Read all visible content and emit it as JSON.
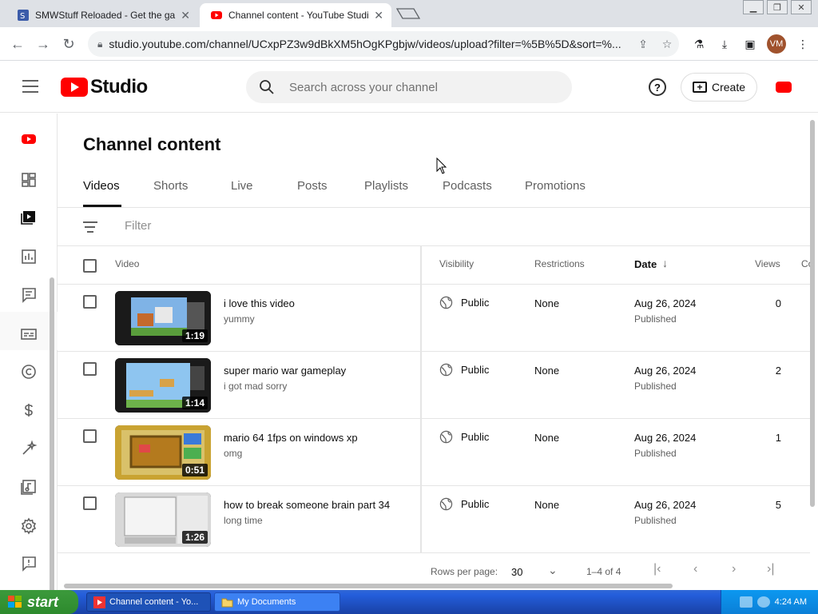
{
  "browser": {
    "tabs": [
      {
        "title": "SMWStuff Reloaded - Get the game",
        "active": false
      },
      {
        "title": "Channel content - YouTube Studio",
        "active": true
      }
    ],
    "url": "studio.youtube.com/channel/UCxpPZ3w9dBkXM5hOgKPgbjw/videos/upload?filter=%5B%5D&sort=%...",
    "profile_initials": "VM"
  },
  "header": {
    "logo_text": "Studio",
    "search_placeholder": "Search across your channel",
    "create_label": "Create"
  },
  "page": {
    "title": "Channel content",
    "tabs": [
      "Videos",
      "Shorts",
      "Live",
      "Posts",
      "Playlists",
      "Podcasts",
      "Promotions"
    ],
    "active_tab": "Videos",
    "filter_placeholder": "Filter"
  },
  "table": {
    "headers": {
      "video": "Video",
      "visibility": "Visibility",
      "restrictions": "Restrictions",
      "date": "Date",
      "views": "Views",
      "comments": "Co"
    },
    "rows": [
      {
        "title": "i love this video",
        "description": "yummy",
        "duration": "1:19",
        "visibility": "Public",
        "restrictions": "None",
        "date": "Aug 26, 2024",
        "status": "Published",
        "views": "0"
      },
      {
        "title": "super mario war gameplay",
        "description": "i got mad sorry",
        "duration": "1:14",
        "visibility": "Public",
        "restrictions": "None",
        "date": "Aug 26, 2024",
        "status": "Published",
        "views": "2"
      },
      {
        "title": "mario 64 1fps on windows xp",
        "description": "omg",
        "duration": "0:51",
        "visibility": "Public",
        "restrictions": "None",
        "date": "Aug 26, 2024",
        "status": "Published",
        "views": "1"
      },
      {
        "title": "how to break someone brain part 34",
        "description": "long time",
        "duration": "1:26",
        "visibility": "Public",
        "restrictions": "None",
        "date": "Aug 26, 2024",
        "status": "Published",
        "views": "5"
      }
    ]
  },
  "pagination": {
    "rows_per_page_label": "Rows per page:",
    "rows_per_page": "30",
    "range": "1–4 of 4"
  },
  "taskbar": {
    "start_label": "start",
    "tasks": [
      "Channel content - Yo...",
      "My Documents"
    ],
    "clock": "4:24 AM"
  },
  "colors": {
    "brand_red": "#ff0000",
    "xp_blue": "#245edb",
    "xp_green": "#2d8a2d"
  },
  "rail_icons": [
    "channel-avatar-icon",
    "dashboard-icon",
    "content-icon",
    "analytics-icon",
    "comments-icon",
    "subtitles-icon",
    "copyright-icon",
    "earn-icon",
    "customization-icon",
    "audio-library-icon",
    "settings-icon",
    "feedback-icon"
  ]
}
